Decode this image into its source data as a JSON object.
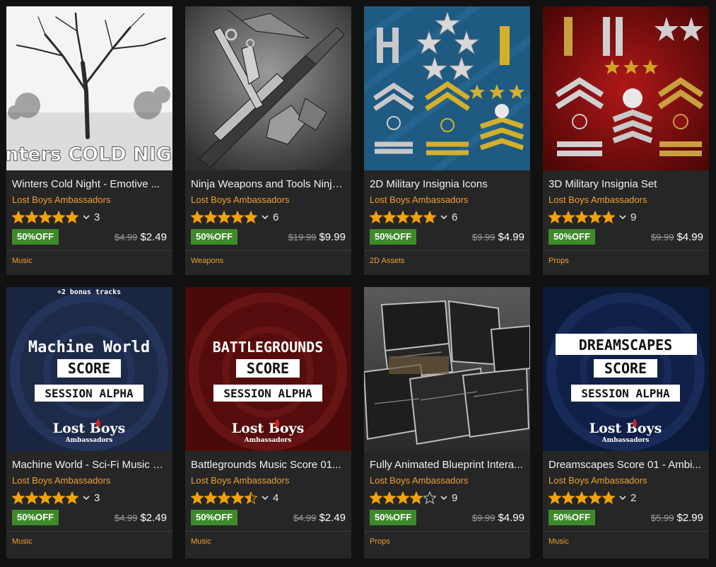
{
  "products": [
    {
      "title": "Winters Cold Night - Emotive ...",
      "publisher": "Lost Boys Ambassadors",
      "rating": 5,
      "rating_count": "3",
      "discount": "50%OFF",
      "old_price": "$4.99",
      "new_price": "$2.49",
      "category": "Music",
      "thumb_text": "Winters COLD NIGHT"
    },
    {
      "title": "Ninja Weapons and Tools Ninja...",
      "publisher": "Lost Boys Ambassadors",
      "rating": 5,
      "rating_count": "6",
      "discount": "50%OFF",
      "old_price": "$19.99",
      "new_price": "$9.99",
      "category": "Weapons"
    },
    {
      "title": "2D Military Insignia Icons",
      "publisher": "Lost Boys Ambassadors",
      "rating": 5,
      "rating_count": "6",
      "discount": "50%OFF",
      "old_price": "$9.99",
      "new_price": "$4.99",
      "category": "2D Assets"
    },
    {
      "title": "3D Military Insignia Set",
      "publisher": "Lost Boys Ambassadors",
      "rating": 5,
      "rating_count": "9",
      "discount": "50%OFF",
      "old_price": "$9.99",
      "new_price": "$4.99",
      "category": "Props"
    },
    {
      "title": "Machine World - Sci-Fi Music S...",
      "publisher": "Lost Boys Ambassadors",
      "rating": 5,
      "rating_count": "3",
      "discount": "50%OFF",
      "old_price": "$4.99",
      "new_price": "$2.49",
      "category": "Music",
      "thumb_top": "+2 bonus tracks",
      "thumb_title": "Machine World",
      "thumb_score": "SCORE",
      "thumb_session": "SESSION ALPHA",
      "thumb_logo": "Lost Boys",
      "thumb_logo_sub": "Ambassadors"
    },
    {
      "title": "Battlegrounds Music Score 01...",
      "publisher": "Lost Boys Ambassadors",
      "rating": 4.5,
      "rating_count": "4",
      "discount": "50%OFF",
      "old_price": "$4.99",
      "new_price": "$2.49",
      "category": "Music",
      "thumb_title": "BATTLEGROUNDS",
      "thumb_score": "SCORE",
      "thumb_session": "SESSION ALPHA",
      "thumb_logo": "Lost Boys",
      "thumb_logo_sub": "Ambassadors"
    },
    {
      "title": "Fully Animated Blueprint Intera...",
      "publisher": "Lost Boys Ambassadors",
      "rating": 4,
      "rating_count": "9",
      "discount": "50%OFF",
      "old_price": "$9.99",
      "new_price": "$4.99",
      "category": "Props"
    },
    {
      "title": "Dreamscapes Score 01 - Ambi...",
      "publisher": "Lost Boys Ambassadors",
      "rating": 5,
      "rating_count": "2",
      "discount": "50%OFF",
      "old_price": "$5.99",
      "new_price": "$2.99",
      "category": "Music",
      "thumb_title": "DREAMSCAPES",
      "thumb_score": "SCORE",
      "thumb_session": "SESSION ALPHA",
      "thumb_logo": "Lost Boys",
      "thumb_logo_sub": "Ambassadors"
    }
  ],
  "colors": {
    "star": "#f2a20c",
    "badge": "#3e8a2a",
    "publisher": "#f0a030"
  }
}
